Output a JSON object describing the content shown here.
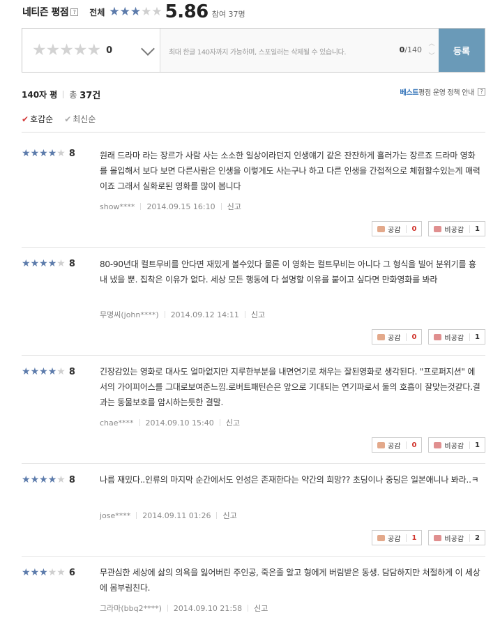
{
  "header": {
    "title": "네티즌 평점",
    "help": "?",
    "all_label": "전체",
    "score": "5.86",
    "stars_filled": 3,
    "participants": "참여 37명"
  },
  "input": {
    "stars_count": 5,
    "rating_value": "0",
    "placeholder": "최대 한글 140자까지 가능하며, 스포일러는 삭제될 수 있습니다.",
    "counter_current": "0",
    "counter_max": "/140",
    "submit_label": "등록"
  },
  "summary": {
    "label": "140자 평",
    "total_prefix": "총",
    "total_value": "37건",
    "policy_best": "베스트",
    "policy_rest": " 평점 운영 정책 안내",
    "policy_help": "?"
  },
  "sort": {
    "options": [
      {
        "label": "호감순",
        "active": true
      },
      {
        "label": "최신순",
        "active": false
      }
    ]
  },
  "vote_labels": {
    "like": "공감",
    "dislike": "비공감"
  },
  "report_label": "신고",
  "reviews": [
    {
      "stars": 4,
      "score": "8",
      "text": "원래 드라마 라는 장르가 사람 사는 소소한 일상이라던지 인생얘기 같은 잔잔하게 흘러가는 장르죠 드라마 영화를 몰입해서 보다 보면 다른사람은 인생을 이렇게도 사는구나 하고 다른 인생을 간접적으로 체험할수있는게 매력이죠 그래서 실화로된 영화를 많이 봅니다",
      "user": "show****",
      "date": "2014.09.15 16:10",
      "likes": "0",
      "dislikes": "1"
    },
    {
      "stars": 4,
      "score": "8",
      "text": "80-90년대 컬트무비를 안다면 재밌게 볼수있다 물론 이 영화는 컬트무비는 아니다 그 형식을 빌어 분위기를 흉내 냈을 뿐. 집착은 이유가 없다. 세상 모든 행동에 다 설명할 이유를 붙이고 싶다면 만화영화를 봐라",
      "user": "무명씨(john****)",
      "date": "2014.09.12 14:11",
      "likes": "0",
      "dislikes": "1"
    },
    {
      "stars": 4,
      "score": "8",
      "text": "긴장감있는 영화로 대사도 얼마없지만 지루한부분을 내면연기로 채우는 잘된영화로 생각된다. \"프로퍼지션\" 에서의 가이피어스를 그대로보여준느낌.로버트패틴슨은 앞으로 기대되는 연기파로서 둘의 호흡이 잘맞는것같다.결과는 동물보호를 암시하는듯한 결말.",
      "user": "chae****",
      "date": "2014.09.10 15:40",
      "likes": "0",
      "dislikes": "1"
    },
    {
      "stars": 4,
      "score": "8",
      "text": "나름 재밌다..인류의 마지막 순간에서도 인성은 존재한다는 약간의 희망?? 초딩이나 중딩은 일본애니나 봐라..ㅋ",
      "user": "jose****",
      "date": "2014.09.11 01:26",
      "likes": "1",
      "dislikes": "2"
    },
    {
      "stars": 3,
      "score": "6",
      "text": "무관심한 세상에 삶의 의욕을 잃어버린 주인공, 죽은줄 알고 형에게 버림받은 동생. 담담하지만 처절하게 이 세상에 몸부림친다.",
      "user": "그라마(bbq2****)",
      "date": "2014.09.10 21:58",
      "likes": "",
      "dislikes": ""
    }
  ]
}
